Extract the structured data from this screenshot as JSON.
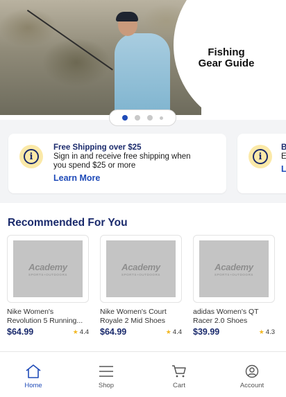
{
  "hero": {
    "title_line1": "Fishing",
    "title_line2": "Gear Guide",
    "carousel_dots": 4,
    "active_dot": 1
  },
  "promos": [
    {
      "icon": "info-icon",
      "title": "Free Shipping over $25",
      "body_line1": "Sign in and receive free shipping when",
      "body_line2": "you spend $25 or more",
      "link": "Learn More"
    },
    {
      "icon": "info-icon",
      "title": "B",
      "body_line1": "E",
      "body_line2": "",
      "link": "L"
    }
  ],
  "recommended": {
    "title": "Recommended For You",
    "placeholder_brand": "Academy",
    "placeholder_sub": "SPORTS+OUTDOORS",
    "products": [
      {
        "name_line1": "Nike Women's",
        "name_line2": "Revolution 5 Running...",
        "price": "$64.99",
        "rating": "4.4"
      },
      {
        "name_line1": "Nike Women's Court",
        "name_line2": "Royale 2 Mid Shoes",
        "price": "$64.99",
        "rating": "4.4"
      },
      {
        "name_line1": "adidas Women's QT",
        "name_line2": "Racer 2.0 Shoes",
        "price": "$39.99",
        "rating": "4.3"
      }
    ]
  },
  "nav": {
    "items": [
      {
        "label": "Home",
        "icon": "home-icon",
        "active": true
      },
      {
        "label": "Shop",
        "icon": "menu-icon",
        "active": false
      },
      {
        "label": "Cart",
        "icon": "cart-icon",
        "active": false
      },
      {
        "label": "Account",
        "icon": "account-icon",
        "active": false
      }
    ]
  },
  "colors": {
    "brand_navy": "#1a2a6c",
    "link_blue": "#1f4bb8",
    "info_yellow": "#fbe9a8",
    "star": "#f2b823"
  }
}
